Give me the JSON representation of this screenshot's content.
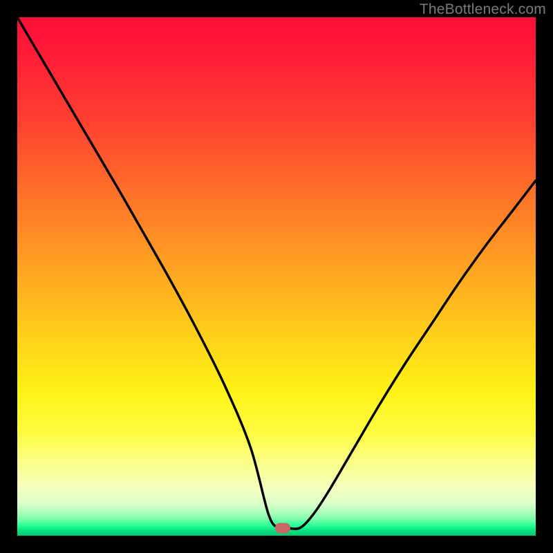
{
  "watermark": "TheBottleneck.com",
  "marker": {
    "x_frac": 0.512,
    "y_frac": 0.985
  },
  "chart_data": {
    "type": "line",
    "title": "",
    "xlabel": "",
    "ylabel": "",
    "xlim": [
      0,
      1
    ],
    "ylim": [
      0,
      1
    ],
    "series": [
      {
        "name": "bottleneck-curve",
        "x": [
          0.0,
          0.1,
          0.2,
          0.28,
          0.34,
          0.4,
          0.45,
          0.485,
          0.505,
          0.52,
          0.545,
          0.57,
          0.6,
          0.65,
          0.7,
          0.75,
          0.8,
          0.85,
          0.9,
          0.95,
          1.0
        ],
        "y": [
          1.0,
          0.83,
          0.66,
          0.52,
          0.41,
          0.29,
          0.17,
          0.04,
          0.015,
          0.015,
          0.015,
          0.04,
          0.085,
          0.17,
          0.255,
          0.335,
          0.41,
          0.485,
          0.555,
          0.62,
          0.685
        ]
      }
    ],
    "annotations": [
      {
        "type": "marker",
        "x": 0.512,
        "y": 0.015,
        "label": "optimal-point"
      }
    ]
  }
}
